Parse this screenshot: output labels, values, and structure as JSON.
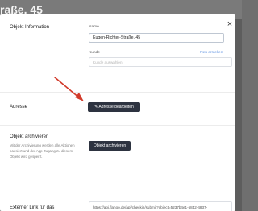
{
  "backdrop": {
    "page_title": "raße, 45"
  },
  "modal": {
    "close_symbol": "×",
    "info": {
      "title": "Objekt Information",
      "name_label": "Name",
      "name_value": "Eugen-Richter-Straße, 45",
      "kunde_label": "Kunde",
      "new_link": "+ Neu erstellen",
      "kunde_placeholder": "Kunde auswählen"
    },
    "address": {
      "title": "Adresse",
      "edit_button": "✎ Adresse bearbeiten"
    },
    "archive": {
      "title": "Objekt archivieren",
      "description": "Mit der Archivierung werden alle Aktionen pausiert und der App-Zugang zu diesem Objekt wird gesperrt.",
      "button": "Objekt archivieren"
    },
    "external_link": {
      "title": "Externer Link für das",
      "value": "https://api.flanoo.de/api/checkin/submit?object=5237b4e1-5842-4837-"
    }
  },
  "colors": {
    "annotation_arrow": "#d23b2b",
    "dark_button": "#2d3340",
    "link": "#5a8fe0"
  },
  "icons": {
    "close": "close-icon",
    "edit": "pencil-icon",
    "annotation": "arrow-annotation-icon"
  }
}
